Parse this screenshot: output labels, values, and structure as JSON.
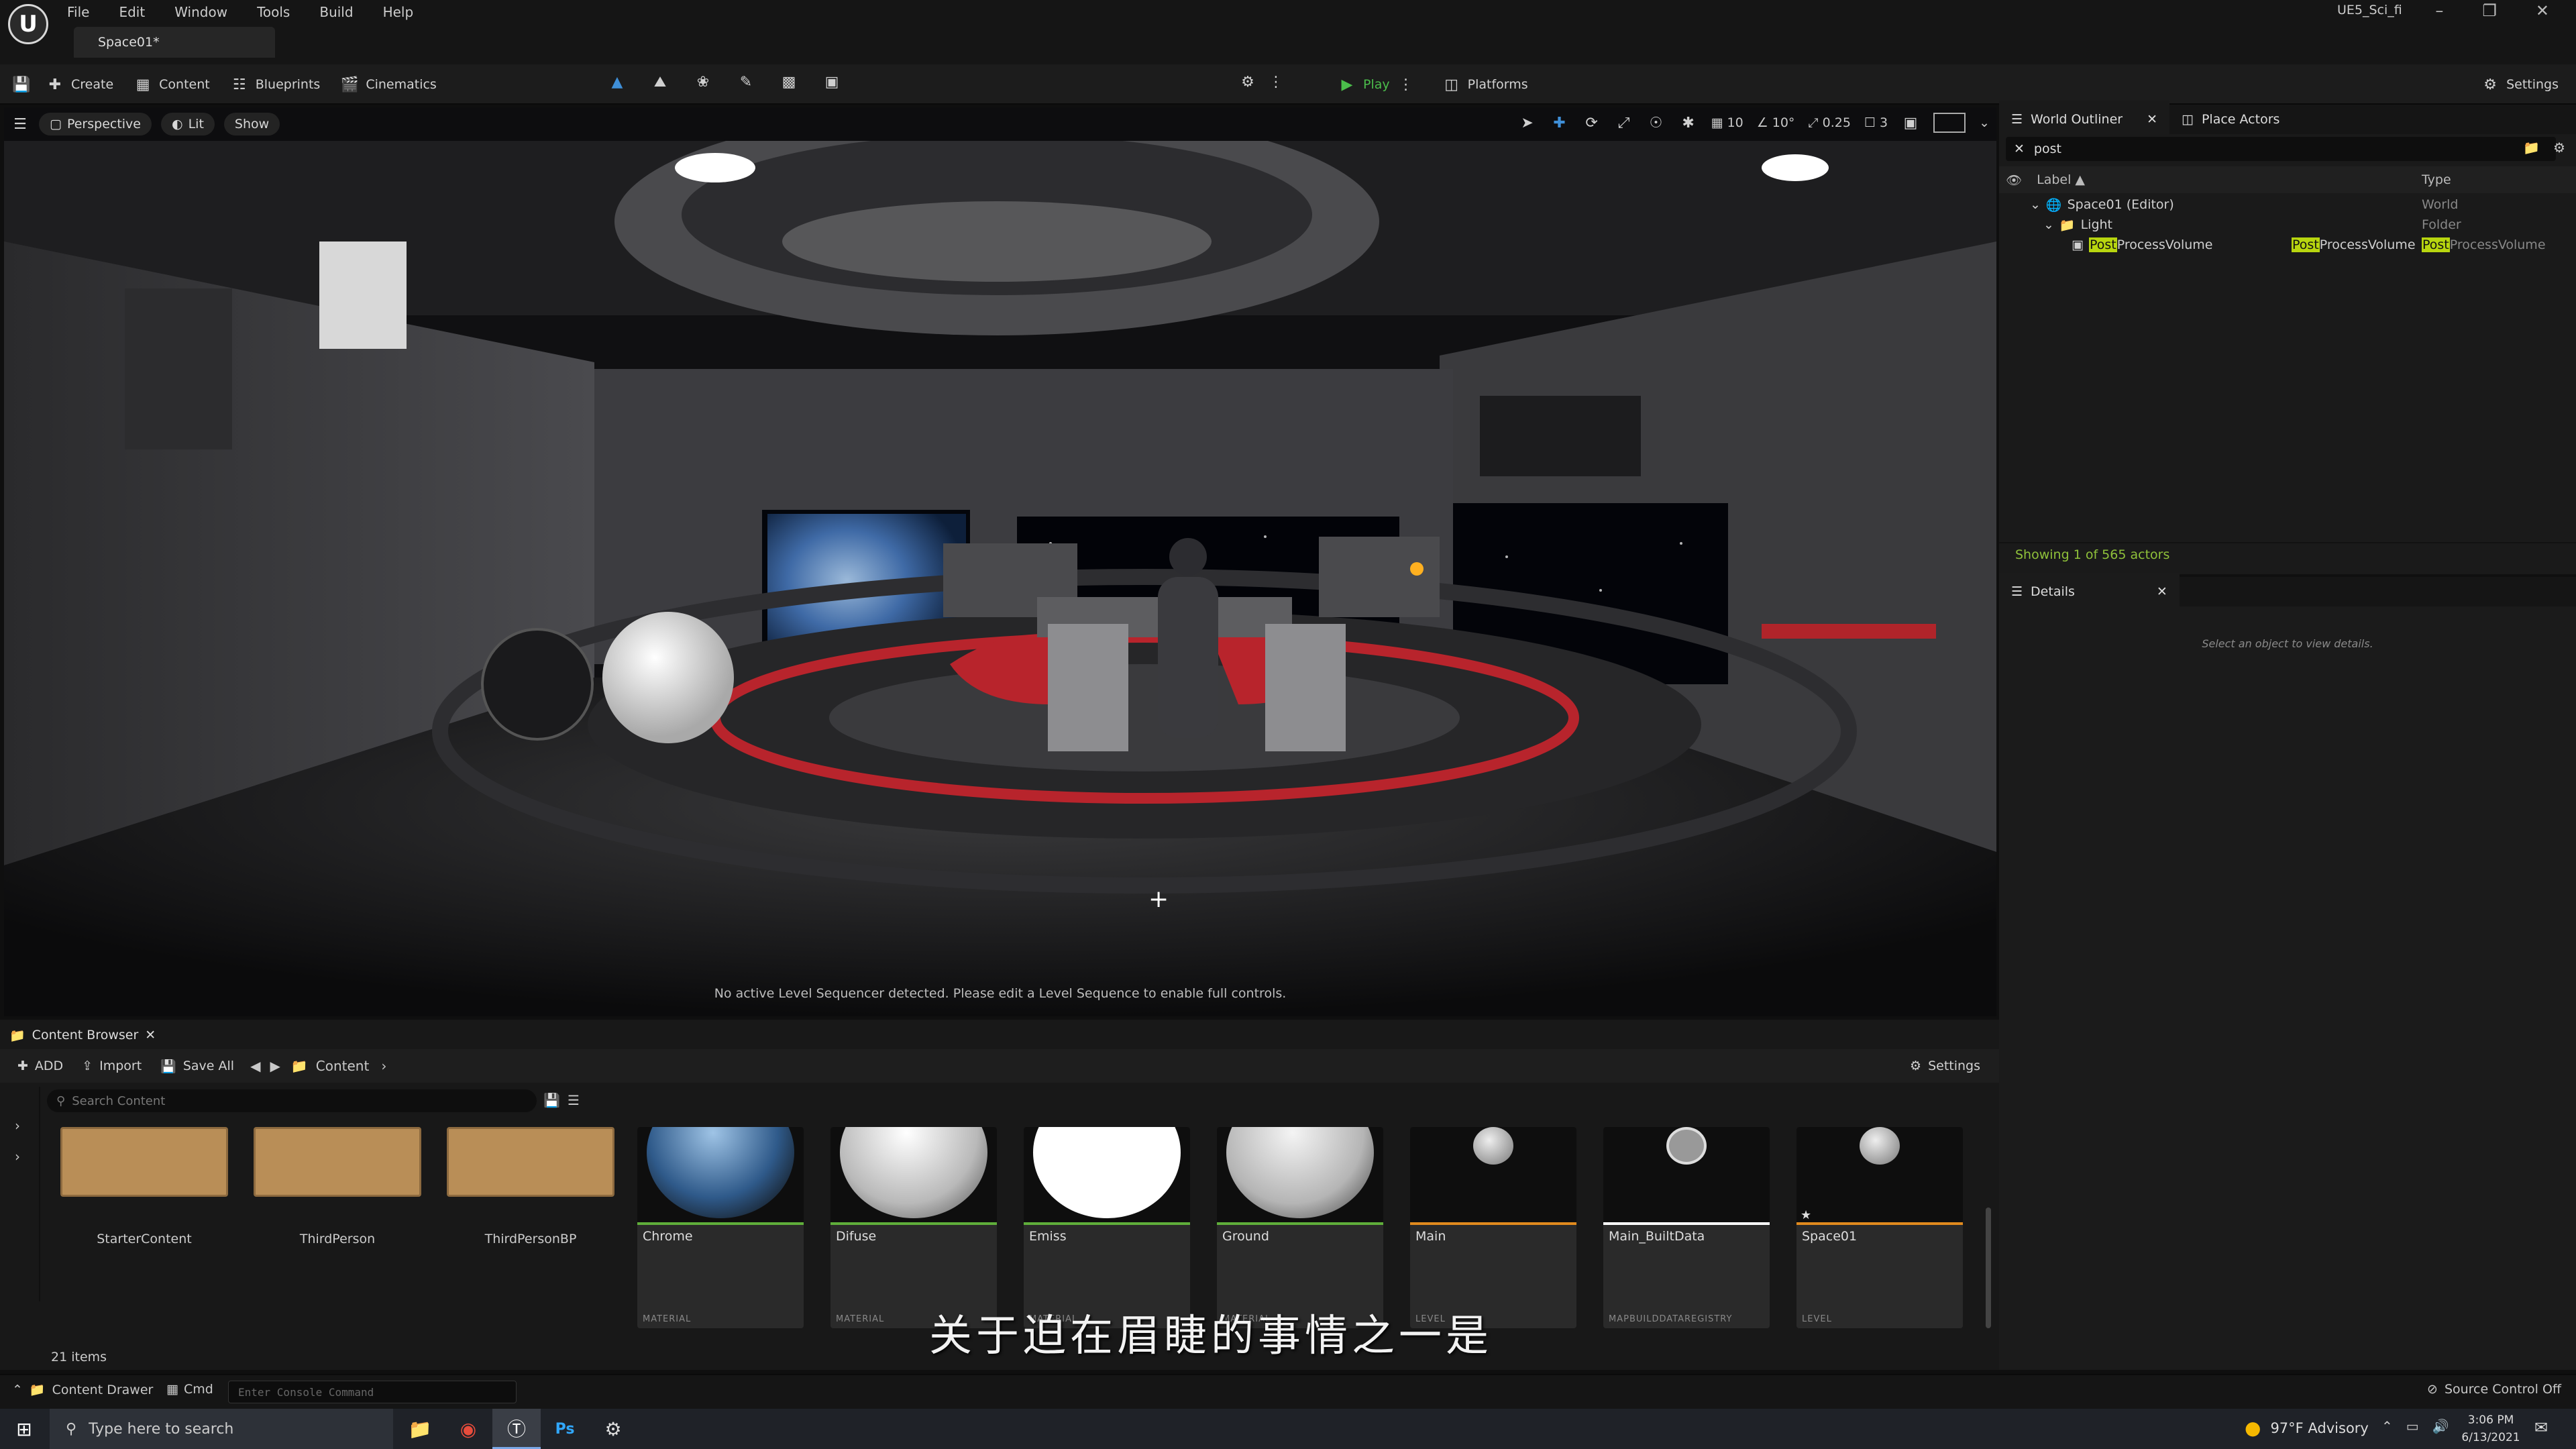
{
  "app": {
    "logo_text": "U",
    "project_name": "UE5_Sci_fi",
    "level_tab": "Space01*",
    "menu": [
      "File",
      "Edit",
      "Window",
      "Tools",
      "Build",
      "Help"
    ]
  },
  "toolbar": {
    "create": "Create",
    "content": "Content",
    "blueprints": "Blueprints",
    "cinematics": "Cinematics",
    "play": "Play",
    "platforms": "Platforms",
    "settings": "Settings"
  },
  "viewport": {
    "perspective": "Perspective",
    "lit": "Lit",
    "show": "Show",
    "grid_snap": "10",
    "rotation_snap": "10°",
    "scale_snap": "0.25",
    "camera_speed": "3",
    "message": "No active Level Sequencer detected. Please edit a Level Sequence to enable full controls."
  },
  "outliner": {
    "tab_title": "World Outliner",
    "place_actors": "Place Actors",
    "search_value": "post",
    "col_label": "Label",
    "col_type": "Type",
    "rows": [
      {
        "label": "Space01 (Editor)",
        "type": "World"
      },
      {
        "label": "Light",
        "type": "Folder"
      }
    ],
    "match_row": {
      "label_hl": "Post",
      "label_rest": "ProcessVolume",
      "mid_hl": "Post",
      "mid_rest": "ProcessVolume",
      "type_hl": "Post",
      "type_rest": "ProcessVolume"
    },
    "status": "Showing 1 of 565 actors"
  },
  "details": {
    "tab_title": "Details",
    "empty_text": "Select an object to view details."
  },
  "content_browser": {
    "tab_title": "Content Browser",
    "add": "ADD",
    "import": "Import",
    "save_all": "Save All",
    "path": "Content",
    "settings": "Settings",
    "search_placeholder": "Search Content",
    "folders": [
      "StarterContent",
      "ThirdPerson",
      "ThirdPersonBP"
    ],
    "assets": [
      {
        "name": "Chrome",
        "type": "MATERIAL"
      },
      {
        "name": "Difuse",
        "type": "MATERIAL"
      },
      {
        "name": "Emiss",
        "type": "MATERIAL"
      },
      {
        "name": "Ground",
        "type": "MATERIAL"
      },
      {
        "name": "Main",
        "type": "LEVEL"
      },
      {
        "name": "Main_BuiltData",
        "type": "MAPBUILDDATAREGISTRY"
      },
      {
        "name": "Space01",
        "type": "LEVEL"
      }
    ],
    "item_count": "21 items"
  },
  "subtitle": "关于迫在眉睫的事情之一是",
  "statusbar": {
    "content_drawer": "Content Drawer",
    "cmd": "Cmd",
    "console_placeholder": "Enter Console Command",
    "source_control": "Source Control Off"
  },
  "taskbar": {
    "search_placeholder": "Type here to search",
    "weather": "97°F  Advisory",
    "time": "3:06 PM",
    "date": "6/13/2021"
  },
  "colors": {
    "accent_green": "#4bbd4b",
    "search_highlight": "#b8d60f",
    "material_bar": "#5fae3a",
    "level_bar": "#e08a1e"
  }
}
